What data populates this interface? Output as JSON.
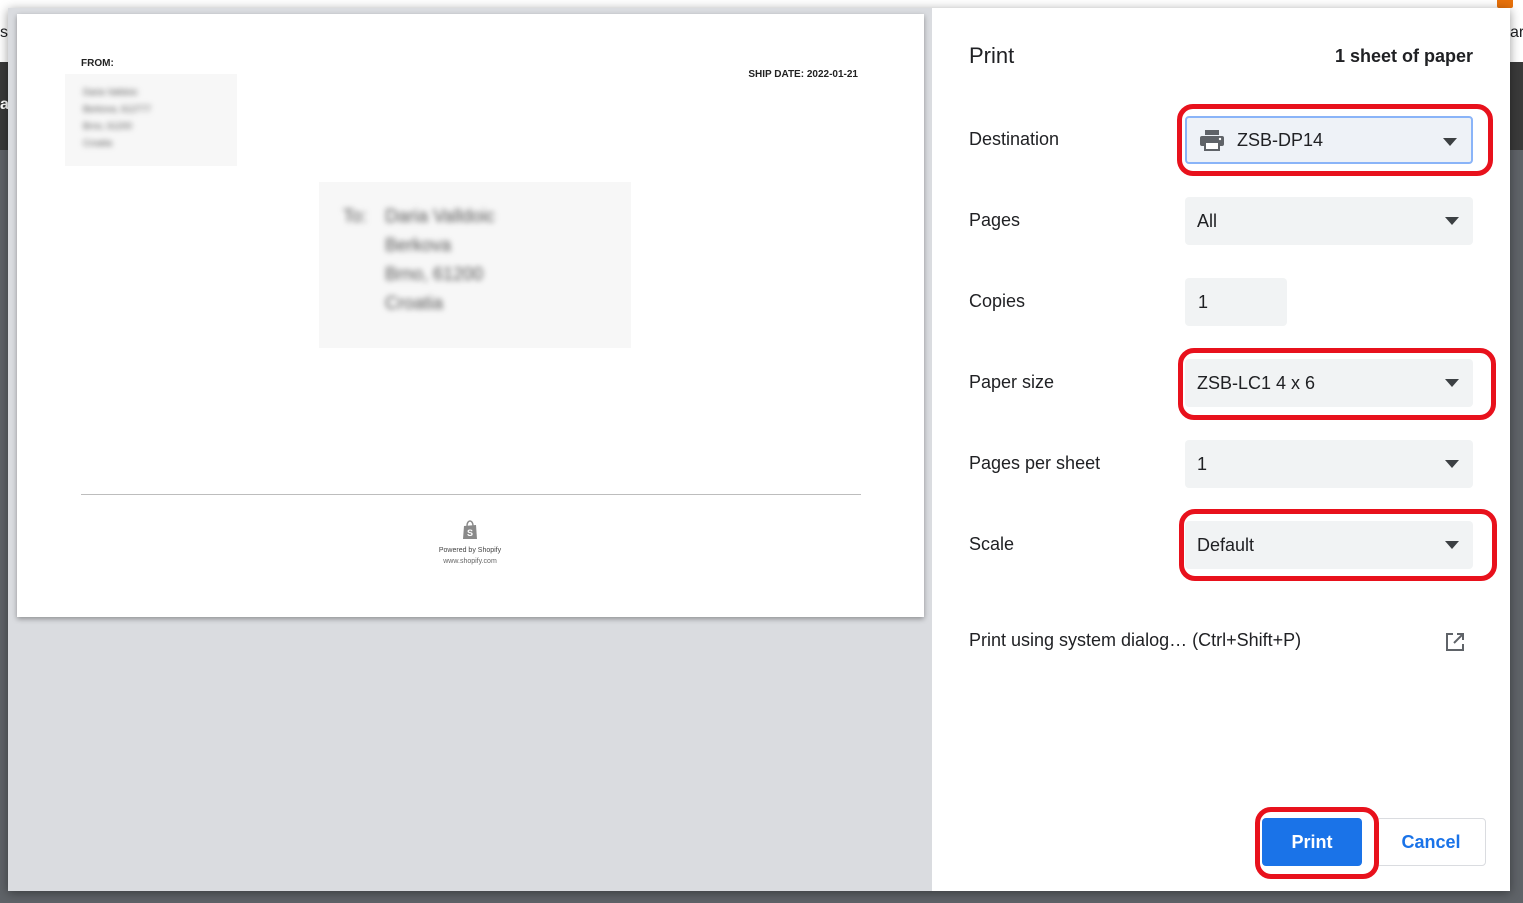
{
  "background": {
    "edge_left_top": "s",
    "edge_left_mid": "a",
    "edge_right_top": "ark"
  },
  "preview": {
    "from_label": "FROM:",
    "from_lines": [
      "Daria Valldoic",
      "Berkova, 612777",
      "Brno, 61200",
      "Croatia"
    ],
    "ship_date": "SHIP DATE: 2022-01-21",
    "to_prefix": "To:",
    "to_lines": [
      "Daria Valldoic",
      "Berkova",
      "Brno, 61200",
      "Croatia"
    ],
    "powered_by": "Powered by Shopify",
    "powered_url": "www.shopify.com",
    "logo_icon": "shopify-bag-icon"
  },
  "panel": {
    "title": "Print",
    "sheet_count": "1 sheet of paper",
    "destination": {
      "label": "Destination",
      "value": "ZSB-DP14",
      "icon": "printer-icon"
    },
    "pages": {
      "label": "Pages",
      "value": "All"
    },
    "copies": {
      "label": "Copies",
      "value": "1"
    },
    "paper_size": {
      "label": "Paper size",
      "value": "ZSB-LC1 4 x 6"
    },
    "pages_per_sheet": {
      "label": "Pages per sheet",
      "value": "1"
    },
    "scale": {
      "label": "Scale",
      "value": "Default"
    },
    "system_dialog": "Print using system dialog… (Ctrl+Shift+P)",
    "system_dialog_icon": "open-in-new-icon",
    "print_button": "Print",
    "cancel_button": "Cancel"
  },
  "colors": {
    "accent": "#1a73e8",
    "highlight": "#e8111c",
    "panel_bg": "#ffffff",
    "preview_bg": "#dadce0",
    "field_bg": "#f1f3f4"
  }
}
